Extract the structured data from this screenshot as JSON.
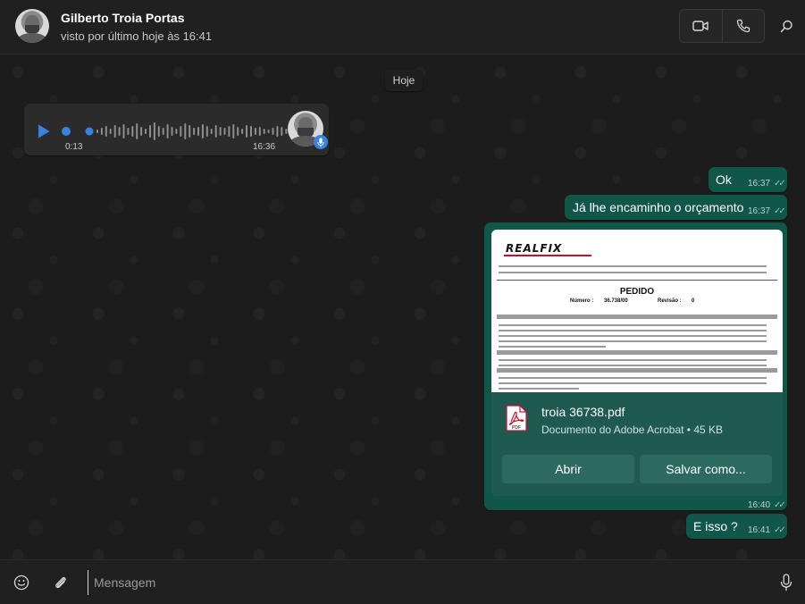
{
  "header": {
    "contact_name": "Gilberto Troia Portas",
    "contact_status": "visto por último hoje às 16:41",
    "icons": [
      "video-icon",
      "phone-icon",
      "search-icon"
    ]
  },
  "chat": {
    "date_divider": "Hoje",
    "voice_message": {
      "elapsed": "0:13",
      "timestamp": "16:36",
      "progress": 0.0
    },
    "messages": [
      {
        "text": "Ok",
        "time": "16:37"
      },
      {
        "text": "Já lhe encaminho o orçamento",
        "time": "16:37"
      },
      {
        "text": "E isso ?",
        "time": "16:41"
      }
    ],
    "document": {
      "preview": {
        "logo": "REALFIX",
        "title": "PEDIDO",
        "number_label": "Número :",
        "number": "36.738/00",
        "revision_label": "Revisão :",
        "revision": "0"
      },
      "file_name": "troia 36738.pdf",
      "file_meta": "Documento do Adobe Acrobat • 45 KB",
      "open_label": "Abrir",
      "save_label": "Salvar como...",
      "time": "16:40"
    }
  },
  "footer": {
    "placeholder": "Mensagem",
    "icons": [
      "emoji-icon",
      "attach-icon",
      "mic-icon"
    ]
  },
  "colors": {
    "outgoing_bubble": "#10574a",
    "incoming_bubble": "#2b2b2b",
    "play_accent": "#3b82e0"
  }
}
